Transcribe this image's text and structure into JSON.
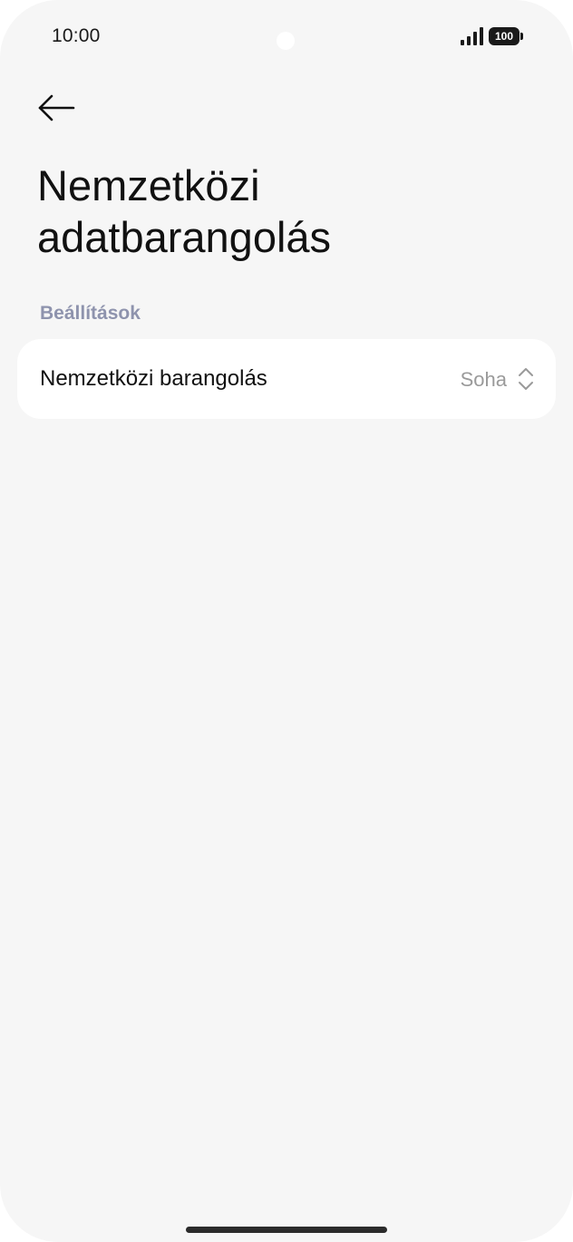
{
  "status_bar": {
    "time": "10:00",
    "battery_level": "100",
    "signal_icon": "cellular-signal-icon"
  },
  "navigation": {
    "back_icon": "arrow-left-icon"
  },
  "page": {
    "title": "Nemzetközi adatbarangolás"
  },
  "settings": {
    "section_header": "Beállítások",
    "rows": [
      {
        "label": "Nemzetközi barangolás",
        "value": "Soha",
        "icon": "chevron-up-down-icon"
      }
    ]
  }
}
